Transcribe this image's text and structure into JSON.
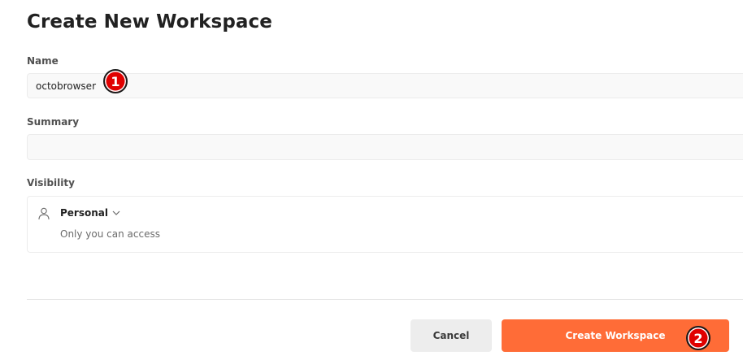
{
  "page_title": "Create New Workspace",
  "form": {
    "name": {
      "label": "Name",
      "value": "octobrowser"
    },
    "summary": {
      "label": "Summary",
      "value": ""
    },
    "visibility": {
      "label": "Visibility",
      "icon": "user-icon",
      "selected": "Personal",
      "description": "Only you can access"
    }
  },
  "actions": {
    "cancel_label": "Cancel",
    "create_label": "Create Workspace"
  },
  "markers": [
    "1",
    "2"
  ],
  "colors": {
    "accent": "#ff6c37",
    "marker": "#e00000"
  }
}
